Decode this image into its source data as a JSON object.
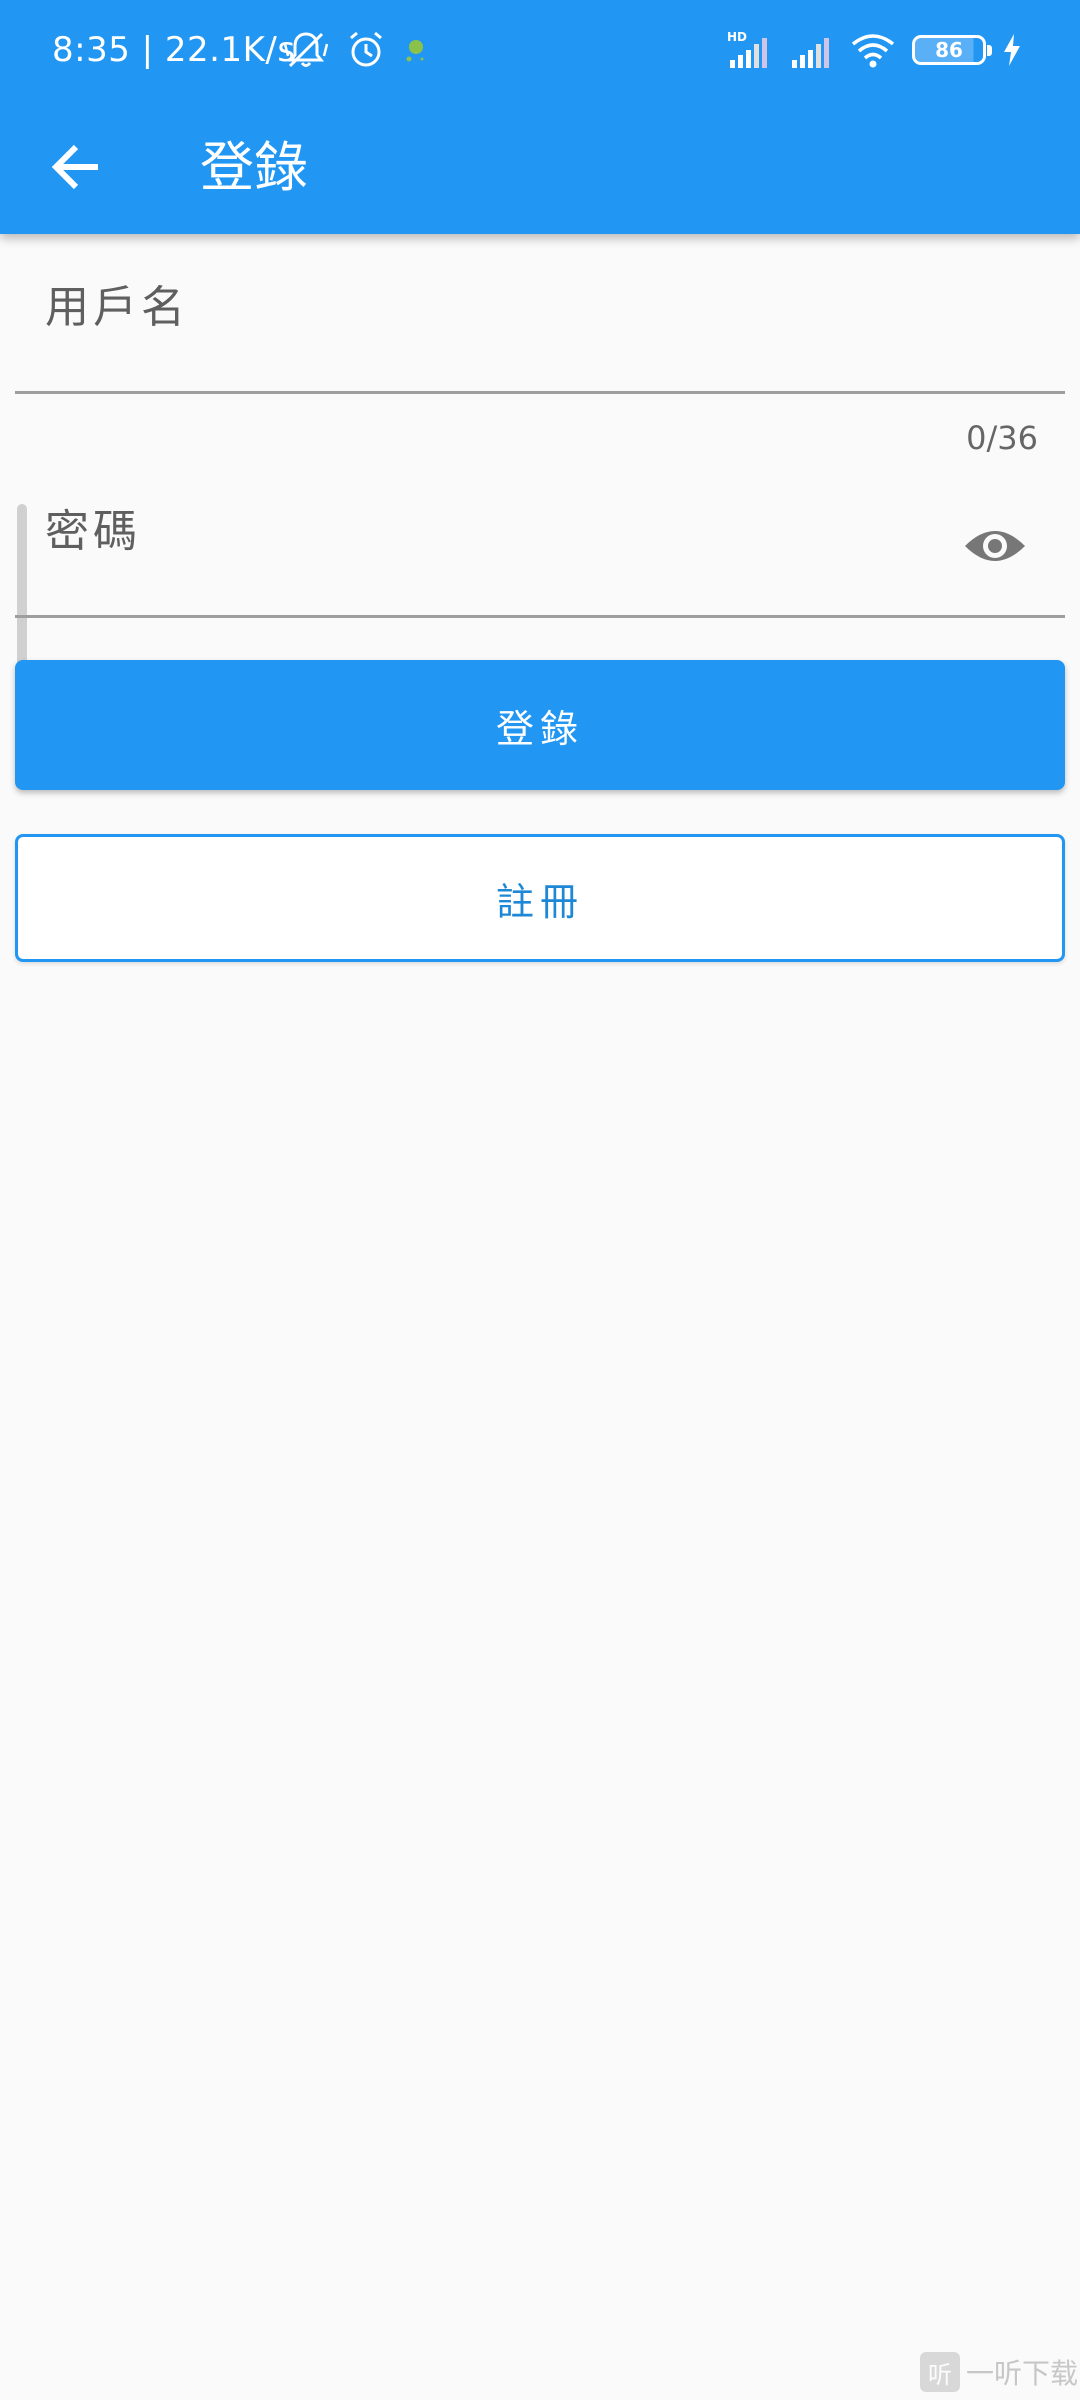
{
  "status_bar": {
    "time_speed": "8:35 | 22.1K/s",
    "battery_level": "86",
    "icons": [
      "mute-bell-icon",
      "alarm-icon",
      "app-notification-icon",
      "signal-hd-icon",
      "signal-icon",
      "wifi-icon",
      "battery-icon",
      "charging-icon"
    ]
  },
  "app_bar": {
    "title": "登錄",
    "back_icon": "arrow-back-icon"
  },
  "form": {
    "username": {
      "label": "用戶名",
      "value": "",
      "counter": "0/36"
    },
    "password": {
      "label": "密碼",
      "value": "",
      "visibility_icon": "eye-icon"
    }
  },
  "buttons": {
    "login": "登錄",
    "register": "註冊"
  },
  "watermark": {
    "logo": "听",
    "text": "一听下载"
  },
  "colors": {
    "primary": "#2196f3",
    "background": "#fafafa",
    "label_gray": "#5f5f5f"
  }
}
